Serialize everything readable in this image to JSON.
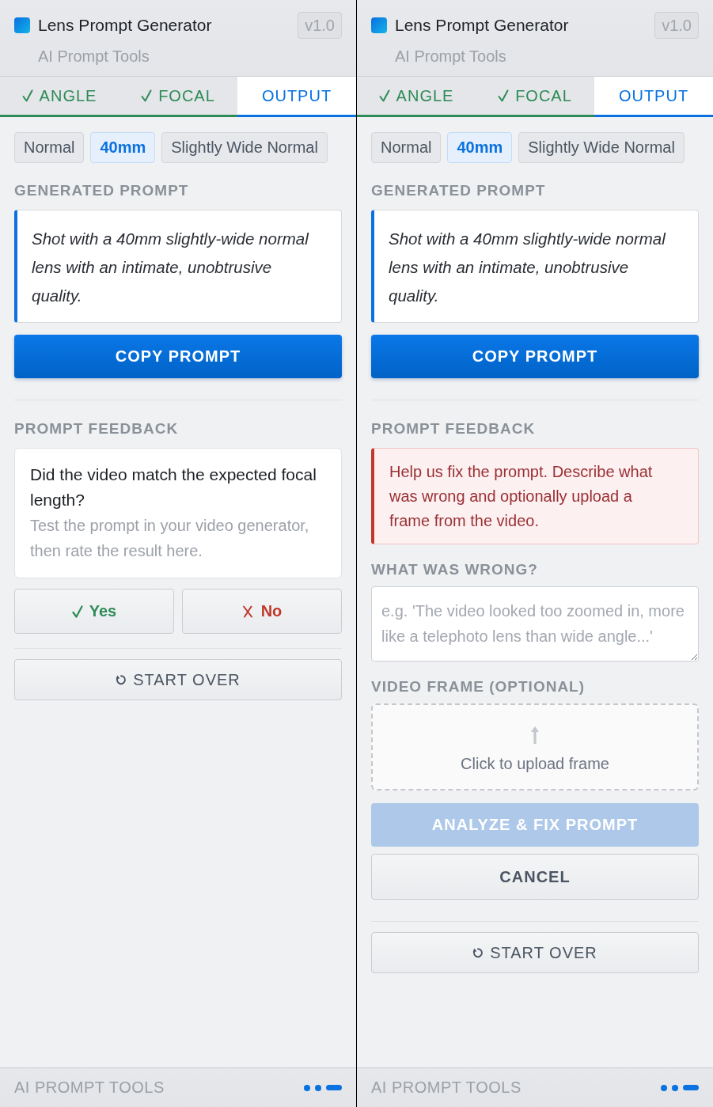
{
  "panels": [
    {
      "header": {
        "title": "Lens Prompt Generator",
        "subtitle": "AI Prompt Tools",
        "version": "v1.0"
      },
      "tabs": [
        {
          "label": "ANGLE",
          "completed": true,
          "selected": false
        },
        {
          "label": "FOCAL",
          "completed": true,
          "selected": false
        },
        {
          "label": "OUTPUT",
          "completed": false,
          "selected": true
        }
      ],
      "chips": [
        {
          "label": "Normal",
          "highlighted": false
        },
        {
          "label": "40mm",
          "highlighted": true
        },
        {
          "label": "Slightly Wide Normal",
          "highlighted": false
        }
      ],
      "prompt": {
        "label": "GENERATED PROMPT",
        "text": "Shot with a 40mm slightly-wide normal lens with an intimate, unobtrusive quality.",
        "button": "COPY PROMPT"
      },
      "feedback": {
        "label": "PROMPT FEEDBACK",
        "kind": "question",
        "question": "Did the video match the expected focal length?",
        "hint": "Test the prompt in your video generator, then rate the result here.",
        "buttons": [
          {
            "label": "Yes",
            "kind": "positive",
            "disabled": false
          },
          {
            "label": "No",
            "kind": "negative",
            "disabled": false
          }
        ]
      },
      "start_over": "START OVER",
      "footer": {
        "brand": "AI PROMPT TOOLS",
        "steps": [
          {
            "selected": false
          },
          {
            "selected": false
          },
          {
            "selected": true
          }
        ]
      }
    },
    {
      "header": {
        "title": "Lens Prompt Generator",
        "subtitle": "AI Prompt Tools",
        "version": "v1.0"
      },
      "tabs": [
        {
          "label": "ANGLE",
          "completed": true,
          "selected": false
        },
        {
          "label": "FOCAL",
          "completed": true,
          "selected": false
        },
        {
          "label": "OUTPUT",
          "completed": false,
          "selected": true
        }
      ],
      "chips": [
        {
          "label": "Normal",
          "highlighted": false
        },
        {
          "label": "40mm",
          "highlighted": true
        },
        {
          "label": "Slightly Wide Normal",
          "highlighted": false
        }
      ],
      "prompt": {
        "label": "GENERATED PROMPT",
        "text": "Shot with a 40mm slightly-wide normal lens with an intimate, unobtrusive quality.",
        "button": "COPY PROMPT"
      },
      "feedback": {
        "label": "PROMPT FEEDBACK",
        "kind": "form",
        "notice": "Help us fix the prompt. Describe what was wrong and optionally upload a frame from the video.",
        "fields": [
          {
            "kind": "textarea",
            "label": "WHAT WAS WRONG?",
            "placeholder": "e.g. 'The video looked too zoomed in, more like a telephoto lens than wide angle...'"
          },
          {
            "kind": "upload",
            "label": "VIDEO FRAME (OPTIONAL)",
            "prompt": "Click to upload frame"
          }
        ],
        "buttons": [
          {
            "label": "ANALYZE & FIX PROMPT",
            "kind": "primary",
            "disabled": true
          },
          {
            "label": "CANCEL",
            "kind": "secondary",
            "disabled": false
          }
        ]
      },
      "start_over": "START OVER",
      "footer": {
        "brand": "AI PROMPT TOOLS",
        "steps": [
          {
            "selected": false
          },
          {
            "selected": false
          },
          {
            "selected": true
          }
        ]
      }
    }
  ]
}
